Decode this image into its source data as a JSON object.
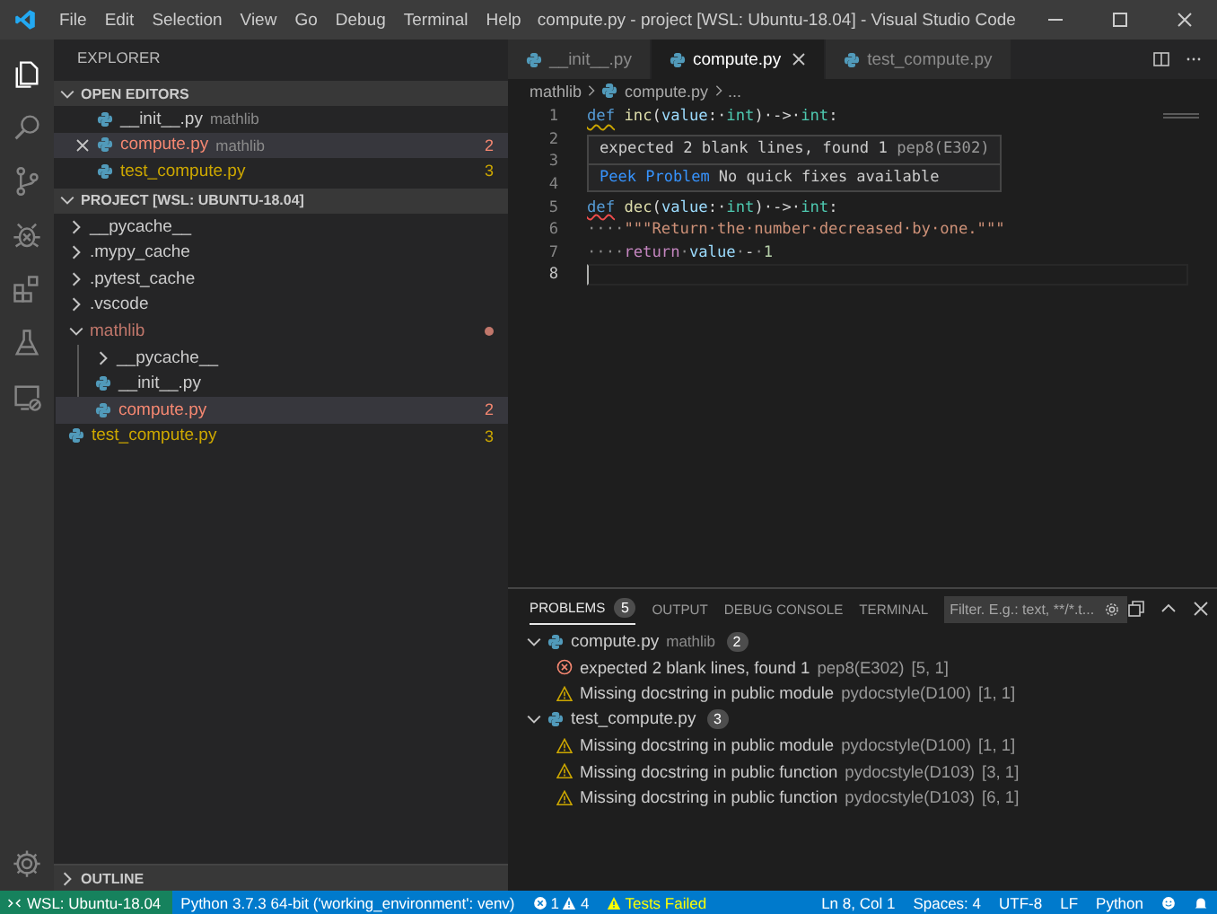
{
  "window": {
    "title": "compute.py - project [WSL: Ubuntu-18.04] - Visual Studio Code"
  },
  "menu": [
    "File",
    "Edit",
    "Selection",
    "View",
    "Go",
    "Debug",
    "Terminal",
    "Help"
  ],
  "sidebar": {
    "title": "EXPLORER",
    "open_editors": {
      "title": "OPEN EDITORS",
      "expanded": true,
      "items": [
        {
          "name": "__init__.py",
          "folder": "mathlib",
          "selected": false
        },
        {
          "name": "compute.py",
          "folder": "mathlib",
          "color": "#f48771",
          "count": "2",
          "selected": true
        },
        {
          "name": "test_compute.py",
          "color": "#cca700",
          "count": "3",
          "selected": false
        }
      ]
    },
    "project": {
      "title": "PROJECT [WSL: UBUNTU-18.04]",
      "expanded": true,
      "children": [
        {
          "name": "__pycache__",
          "kind": "folder",
          "expanded": false,
          "selected": false
        },
        {
          "name": ".mypy_cache",
          "kind": "folder",
          "expanded": false,
          "selected": false
        },
        {
          "name": ".pytest_cache",
          "kind": "folder",
          "expanded": false,
          "selected": false
        },
        {
          "name": ".vscode",
          "kind": "folder",
          "expanded": false,
          "selected": false
        },
        {
          "name": "mathlib",
          "kind": "folder",
          "expanded": true,
          "color": "#c1776b",
          "selected": false,
          "children": [
            {
              "name": "__pycache__",
              "kind": "folder",
              "expanded": false,
              "selected": false
            },
            {
              "name": "__init__.py",
              "kind": "file",
              "selected": false
            },
            {
              "name": "compute.py",
              "kind": "file",
              "color": "#f48771",
              "count": "2",
              "selected": true
            }
          ]
        },
        {
          "name": "test_compute.py",
          "kind": "file",
          "color": "#cca700",
          "count": "3",
          "selected": false
        }
      ]
    },
    "outline": {
      "title": "OUTLINE",
      "expanded": false
    }
  },
  "editor": {
    "tabs": [
      {
        "label": "__init__.py",
        "selected": false
      },
      {
        "label": "compute.py",
        "selected": true
      },
      {
        "label": "test_compute.py",
        "selected": false
      }
    ],
    "breadcrumb": [
      "mathlib",
      "compute.py",
      "..."
    ],
    "lines": [
      {
        "number": "1",
        "current": false,
        "tokens": [
          {
            "kind": "keyword",
            "text": "def",
            "color": "#cca700"
          },
          {
            "kind": "function",
            "text": "inc"
          },
          {
            "kind": "plain",
            "text": "("
          },
          {
            "kind": "param",
            "text": "value"
          },
          {
            "kind": "plain",
            "text": ":·"
          },
          {
            "kind": "type",
            "text": "int"
          },
          {
            "kind": "plain",
            "text": ")·->·"
          },
          {
            "kind": "type",
            "text": "int"
          },
          {
            "kind": "plain",
            "text": ":"
          }
        ]
      },
      {
        "number": "2",
        "current": false
      },
      {
        "number": "3",
        "current": false
      },
      {
        "number": "4",
        "current": false
      },
      {
        "number": "5",
        "current": false,
        "tokens": [
          {
            "kind": "keyword",
            "text": "def",
            "color": "#f14c4c"
          },
          {
            "kind": "function",
            "text": "dec"
          },
          {
            "kind": "plain",
            "text": "("
          },
          {
            "kind": "param",
            "text": "value"
          },
          {
            "kind": "plain",
            "text": ":·"
          },
          {
            "kind": "type",
            "text": "int"
          },
          {
            "kind": "plain",
            "text": ")·->·"
          },
          {
            "kind": "type",
            "text": "int"
          },
          {
            "kind": "plain",
            "text": ":"
          }
        ]
      },
      {
        "number": "6",
        "current": false,
        "tokens": [
          {
            "kind": "space",
            "text": "····"
          },
          {
            "kind": "string",
            "text": "\"\"\"Return·the·number·decreased·by·one.\"\"\""
          }
        ]
      },
      {
        "number": "7",
        "current": false,
        "tokens": [
          {
            "kind": "space",
            "text": "····"
          },
          {
            "kind": "control",
            "text": "return"
          },
          {
            "kind": "space",
            "text": "·"
          },
          {
            "kind": "param",
            "text": "value"
          },
          {
            "kind": "space",
            "text": "·"
          },
          {
            "kind": "plain",
            "text": "-"
          },
          {
            "kind": "space",
            "text": "·"
          },
          {
            "kind": "number",
            "text": "1"
          }
        ]
      },
      {
        "number": "8",
        "current": true
      }
    ],
    "hover": {
      "message": "expected 2 blank lines, found 1",
      "source": "pep8(E302)",
      "action": "Peek Problem",
      "note": "No quick fixes available"
    }
  },
  "panel": {
    "tabs": [
      {
        "label": "PROBLEMS",
        "count": "5",
        "selected": true
      },
      {
        "label": "OUTPUT",
        "selected": false
      },
      {
        "label": "DEBUG CONSOLE",
        "selected": false
      },
      {
        "label": "TERMINAL",
        "selected": false
      }
    ],
    "filter": {
      "placeholder": "Filter. E.g.: text, **/*.t..."
    },
    "groups": [
      {
        "file": "compute.py",
        "folder": "mathlib",
        "count": "2",
        "expanded": true,
        "items": [
          {
            "kind": "error",
            "message": "expected 2 blank lines, found 1",
            "source": "pep8(E302)",
            "position": "[5, 1]"
          },
          {
            "kind": "warning",
            "message": "Missing docstring in public module",
            "source": "pydocstyle(D100)",
            "position": "[1, 1]"
          }
        ]
      },
      {
        "file": "test_compute.py",
        "count": "3",
        "expanded": true,
        "items": [
          {
            "kind": "warning",
            "message": "Missing docstring in public module",
            "source": "pydocstyle(D100)",
            "position": "[1, 1]"
          },
          {
            "kind": "warning",
            "message": "Missing docstring in public function",
            "source": "pydocstyle(D103)",
            "position": "[3, 1]"
          },
          {
            "kind": "warning",
            "message": "Missing docstring in public function",
            "source": "pydocstyle(D103)",
            "position": "[6, 1]"
          }
        ]
      }
    ]
  },
  "status_bar": {
    "remote": "WSL: Ubuntu-18.04",
    "interpreter": "Python 3.7.3 64-bit ('working_environment': venv)",
    "errors": "1",
    "warnings": "4",
    "tests": "Tests Failed",
    "right": [
      "Ln 8, Col 1",
      "Spaces: 4",
      "UTF-8",
      "LF",
      "Python"
    ]
  }
}
